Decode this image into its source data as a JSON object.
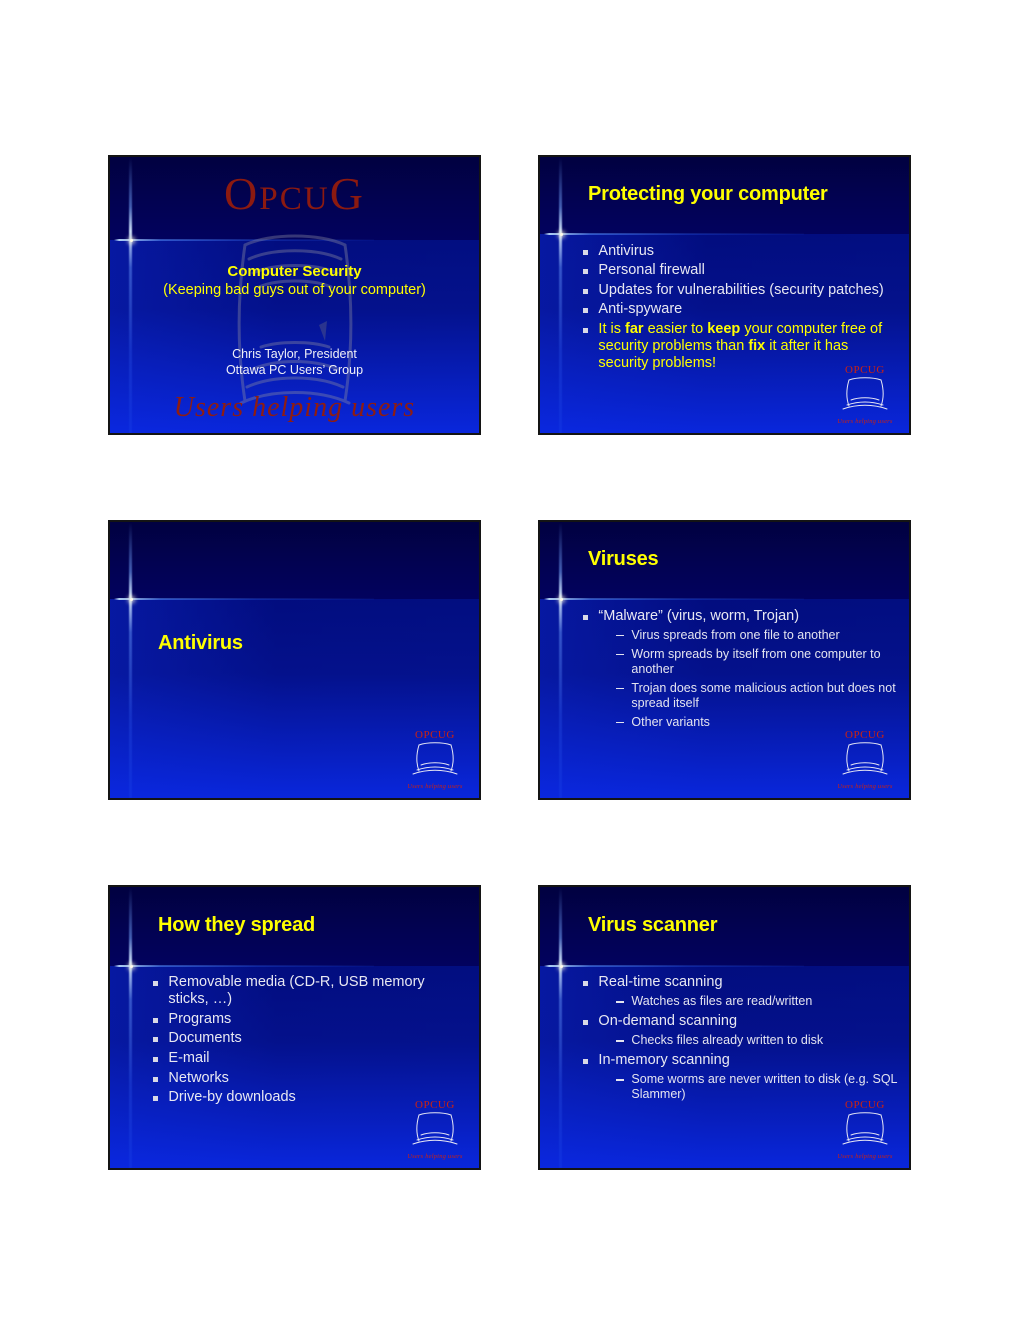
{
  "document": {
    "kind": "powerpoint-handout",
    "background_color": "#ffffff",
    "slide_count": 6
  },
  "brand": {
    "wordmark": "OPCUG",
    "wordmark_letters": [
      "O",
      "PCU",
      "G"
    ],
    "tagline": "Users helping users",
    "accent_red": "#8c1a10",
    "title_yellow": "#ffff00",
    "slide_blue": "#00006b"
  },
  "slides": [
    {
      "id": "slide-1-title",
      "layout": "title",
      "wordmark": "OPCUG",
      "title": "Computer Security",
      "subtitle": "(Keeping bad guys out of your computer)",
      "presenter_name": "Chris Taylor, President",
      "presenter_org": "Ottawa PC Users’ Group",
      "tagline": "Users helping users"
    },
    {
      "id": "slide-2-protecting",
      "layout": "bullets",
      "title": "Protecting your computer",
      "bullets": [
        {
          "text": "Antivirus",
          "accent": false
        },
        {
          "text": "Personal firewall",
          "accent": false
        },
        {
          "text": "Updates for vulnerabilities (security patches)",
          "accent": false
        },
        {
          "text": "Anti-spyware",
          "accent": false
        },
        {
          "text": "It is far easier to keep your computer free of security problems than fix it after it has security problems!",
          "accent": true,
          "bold_words": [
            "far",
            "keep",
            "fix"
          ]
        }
      ]
    },
    {
      "id": "slide-3-antivirus",
      "layout": "section",
      "title": "Antivirus",
      "bullets": []
    },
    {
      "id": "slide-4-viruses",
      "layout": "bullets",
      "title": "Viruses",
      "bullets": [
        {
          "text": "“Malware” (virus, worm, Trojan)",
          "accent": false,
          "sub": [
            "Virus spreads from one file to another",
            "Worm spreads by itself from one computer to another",
            "Trojan does some malicious action but does not spread itself",
            "Other variants"
          ]
        }
      ]
    },
    {
      "id": "slide-5-how-they-spread",
      "layout": "bullets",
      "title": "How they spread",
      "bullets": [
        {
          "text": "Removable media (CD-R, USB memory sticks, …)",
          "accent": false
        },
        {
          "text": "Programs",
          "accent": false
        },
        {
          "text": "Documents",
          "accent": false
        },
        {
          "text": "E-mail",
          "accent": false
        },
        {
          "text": "Networks",
          "accent": false
        },
        {
          "text": "Drive-by downloads",
          "accent": false
        }
      ]
    },
    {
      "id": "slide-6-virus-scanner",
      "layout": "bullets",
      "title": "Virus scanner",
      "bullets": [
        {
          "text": "Real-time scanning",
          "accent": false,
          "sub": [
            "Watches as files are read/written"
          ]
        },
        {
          "text": "On-demand scanning",
          "accent": false,
          "sub": [
            "Checks files already written to disk"
          ]
        },
        {
          "text": "In-memory scanning",
          "accent": false,
          "sub": [
            "Some worms are never written to disk (e.g. SQL Slammer)"
          ]
        }
      ]
    }
  ]
}
